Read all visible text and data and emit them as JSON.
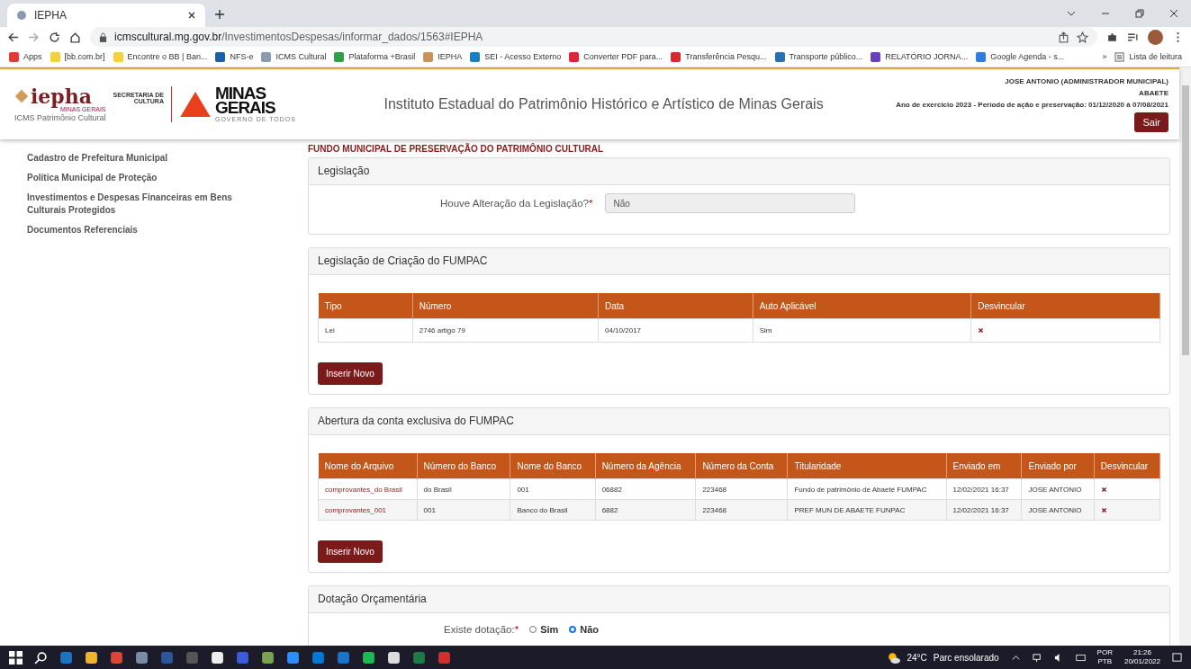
{
  "browser": {
    "tab_title": "IEPHA",
    "url_host": "icmscultural.mg.gov.br",
    "url_path": "/InvestimentosDespesas/informar_dados/1563#IEPHA",
    "bookmarks": [
      {
        "label": "Apps",
        "color": "#e53935"
      },
      {
        "label": "[bb.com.br]",
        "color": "#f4d03f"
      },
      {
        "label": "Encontre o BB | Ban...",
        "color": "#f4d03f"
      },
      {
        "label": "NFS-e",
        "color": "#1e5fa8"
      },
      {
        "label": "ICMS Cultural",
        "color": "#8a9bb0"
      },
      {
        "label": "Plataforma +Brasil",
        "color": "#2e9e47"
      },
      {
        "label": "IEPHA",
        "color": "#c8925a"
      },
      {
        "label": "SEI - Acesso Externo",
        "color": "#1a7fc0"
      },
      {
        "label": "Converter PDF para...",
        "color": "#e0253a"
      },
      {
        "label": "Transferência Pesqu...",
        "color": "#d9262e"
      },
      {
        "label": "Transporte público...",
        "color": "#2a6fb5"
      },
      {
        "label": "RELATÓRIO JORNA...",
        "color": "#6a3fc4"
      },
      {
        "label": "Google Agenda - s...",
        "color": "#2f7de1"
      }
    ],
    "more": "»",
    "reading_list": "Lista de leitura"
  },
  "header": {
    "logo_name": "iepha",
    "logo_sub": "MINAS GERAIS",
    "logo_caption": "ICMS Patrimônio Cultural",
    "secretaria_1": "SECRETARIA DE",
    "secretaria_2": "CULTURA",
    "state_1": "MINAS",
    "state_2": "GERAIS",
    "state_motto": "GOVERNO DE TODOS",
    "title": "Instituto Estadual do Patrimônio Histórico e Artístico de Minas Gerais",
    "user": "JOSE ANTONIO  (ADMINISTRADOR MUNICIPAL)",
    "city": "ABAETE",
    "period": "Ano de exercicio 2023 - Período de ação e preservação: 01/12/2020 à 07/08/2021",
    "logout": "Sair"
  },
  "sidebar": {
    "items": [
      {
        "label": "Cadastro de Prefeitura Municipal"
      },
      {
        "label": "Política Municipal de Proteção"
      },
      {
        "label": "Investimentos e Despesas Financeiras em Bens Culturais Protegidos"
      },
      {
        "label": "Documentos Referenciais"
      }
    ]
  },
  "main": {
    "title": "FUNDO MUNICIPAL DE PRESERVAÇÃO DO PATRIMÔNIO CULTURAL",
    "legislacao": {
      "heading": "Legislação",
      "label": "Houve Alteração da Legislação?",
      "required": "*",
      "value": "Não"
    },
    "criacao": {
      "heading": "Legislação de Criação do FUMPAC",
      "columns": [
        "Tipo",
        "Número",
        "Data",
        "Auto Aplicável",
        "Desvincular"
      ],
      "rows": [
        {
          "cells": [
            "Lei",
            "2746 artigo 79",
            "04/10/2017",
            "Sim"
          ]
        }
      ],
      "button": "Inserir Novo"
    },
    "conta": {
      "heading": "Abertura da conta exclusiva do FUMPAC",
      "columns": [
        "Nome do Arquivo",
        "Número do Banco",
        "Nome do Banco",
        "Número da Agência",
        "Número da Conta",
        "Titularidade",
        "Enviado em",
        "Enviado por",
        "Desvincular"
      ],
      "rows": [
        {
          "cells": [
            "comprovantes_do Brasil",
            "do Brasil",
            "001",
            "06882",
            "223468",
            "Fundo de patrimônio de Abaeté FUMPAC",
            "12/02/2021 16:37",
            "JOSE ANTONIO"
          ]
        },
        {
          "cells": [
            "comprovantes_001",
            "001",
            "Banco do Brasil",
            "6882",
            "223468",
            "PREF MUN DE ABAETE FUNPAC",
            "12/02/2021 16:37",
            "JOSE ANTONIO"
          ]
        }
      ],
      "button": "Inserir Novo"
    },
    "dotacao": {
      "heading": "Dotação Orçamentária",
      "label": "Existe dotação:",
      "required": "*",
      "options": [
        {
          "label": "Sim",
          "selected": false
        },
        {
          "label": "Não",
          "selected": true
        }
      ]
    }
  },
  "taskbar": {
    "temperature": "24°C",
    "weather": "Parc ensolarado",
    "lang_1": "POR",
    "lang_2": "PTB",
    "time": "21:26",
    "date": "20/01/2022"
  }
}
